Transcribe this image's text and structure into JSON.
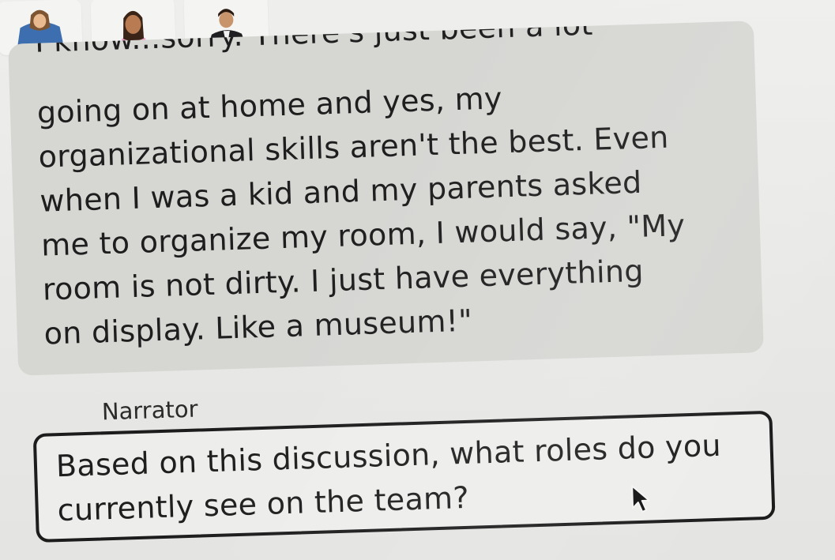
{
  "participants": [
    {
      "name": "participant-1",
      "icon": "person-avatar-icon"
    },
    {
      "name": "participant-2",
      "icon": "person-avatar-icon"
    },
    {
      "name": "participant-3",
      "icon": "person-avatar-icon"
    }
  ],
  "message": {
    "partial_first_line": "I know...sorry. There's just been a lot",
    "text": "going on at home and yes, my\norganizational skills aren't the best. Even\nwhen I was a kid and my parents asked\nme to organize my room, I would say, \"My\nroom is not dirty. I just have everything\non display. Like a museum!\""
  },
  "narrator": {
    "label": "Narrator",
    "prompt": "Based on this discussion, what roles do you currently see on the team?"
  },
  "colors": {
    "bubble_background": "#d6d6d3",
    "narrator_border": "#1c1c1c",
    "page_background": "#e9e9e7"
  }
}
